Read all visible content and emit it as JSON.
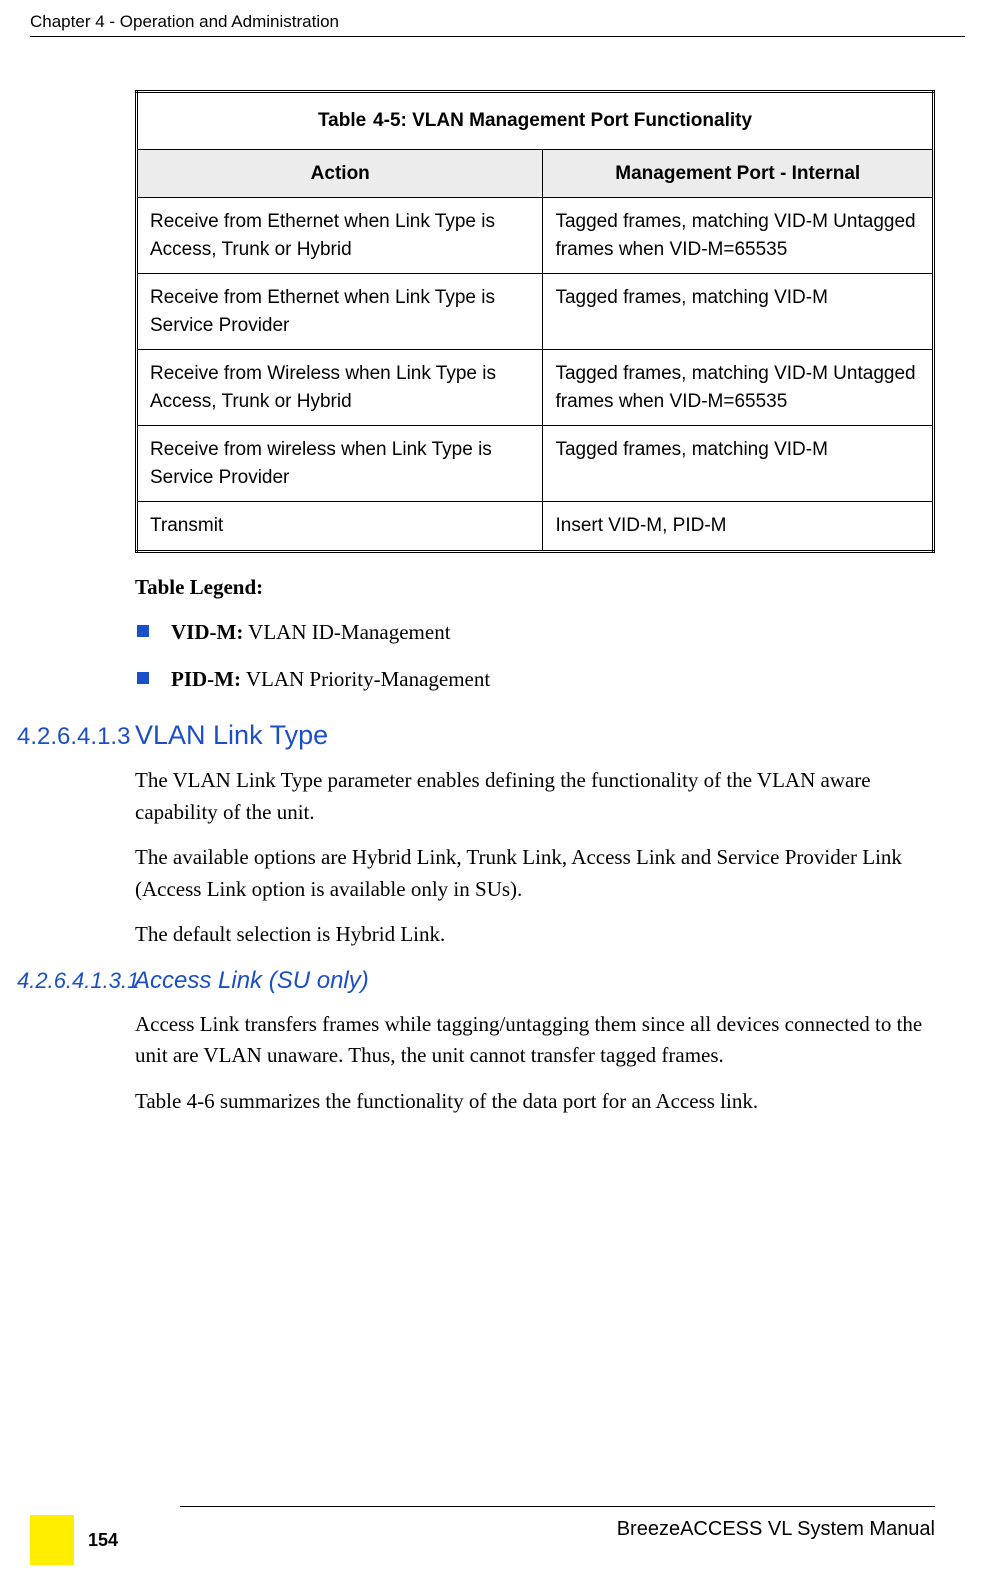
{
  "header": {
    "chapter": "Chapter 4 - Operation and Administration"
  },
  "table": {
    "title": "Table  4-5: VLAN Management Port Functionality",
    "headers": {
      "action": "Action",
      "mgmt": "Management Port - Internal"
    },
    "rows": [
      {
        "action": "Receive from Ethernet when Link Type is Access, Trunk or Hybrid",
        "mgmt": "Tagged frames, matching VID-M Untagged frames when VID-M=65535"
      },
      {
        "action": "Receive from Ethernet when Link Type is Service Provider",
        "mgmt": "Tagged frames, matching VID-M"
      },
      {
        "action": "Receive from Wireless when Link Type is Access, Trunk or Hybrid",
        "mgmt": "Tagged frames, matching VID-M Untagged frames when VID-M=65535"
      },
      {
        "action": "Receive from wireless when Link Type is Service Provider",
        "mgmt": "Tagged frames, matching VID-M"
      },
      {
        "action": "Transmit",
        "mgmt": "Insert VID-M, PID-M"
      }
    ]
  },
  "legend": {
    "title": "Table Legend:",
    "items": [
      {
        "term": "VID-M:",
        "desc": " VLAN ID-Management"
      },
      {
        "term": "PID-M:",
        "desc": " VLAN Priority-Management"
      }
    ]
  },
  "section": {
    "num": "4.2.6.4.1.3",
    "title": "VLAN Link Type",
    "paras": [
      "The VLAN Link Type parameter enables defining the functionality of the VLAN aware capability of the unit.",
      "The available options are Hybrid Link, Trunk Link, Access Link and Service Provider Link (Access Link option is available only in SUs).",
      "The default selection is Hybrid Link."
    ]
  },
  "subsection": {
    "num": "4.2.6.4.1.3.1",
    "title": "Access Link (SU only)",
    "paras": [
      "Access Link transfers frames while tagging/untagging them since all devices connected to the unit are VLAN unaware. Thus, the unit cannot transfer tagged frames.",
      "Table 4-6 summarizes the functionality of the data port for an Access link."
    ]
  },
  "footer": {
    "page": "154",
    "manual": "BreezeACCESS VL System Manual"
  }
}
